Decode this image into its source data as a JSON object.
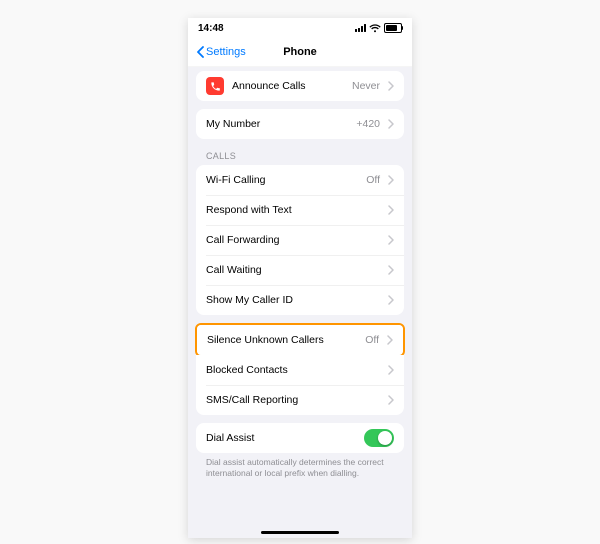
{
  "status": {
    "time": "14:48"
  },
  "nav": {
    "back_label": "Settings",
    "title": "Phone"
  },
  "announce": {
    "label": "Announce Calls",
    "value": "Never"
  },
  "my_number": {
    "label": "My Number",
    "value": "+420"
  },
  "calls_header": "CALLS",
  "calls": [
    {
      "label": "Wi-Fi Calling",
      "value": "Off"
    },
    {
      "label": "Respond with Text",
      "value": ""
    },
    {
      "label": "Call Forwarding",
      "value": ""
    },
    {
      "label": "Call Waiting",
      "value": ""
    },
    {
      "label": "Show My Caller ID",
      "value": ""
    }
  ],
  "silence_unknown": {
    "label": "Silence Unknown Callers",
    "value": "Off"
  },
  "below": [
    {
      "label": "Blocked Contacts"
    },
    {
      "label": "SMS/Call Reporting"
    }
  ],
  "dial_assist": {
    "label": "Dial Assist",
    "footer": "Dial assist automatically determines the correct international or local prefix when dialling."
  }
}
